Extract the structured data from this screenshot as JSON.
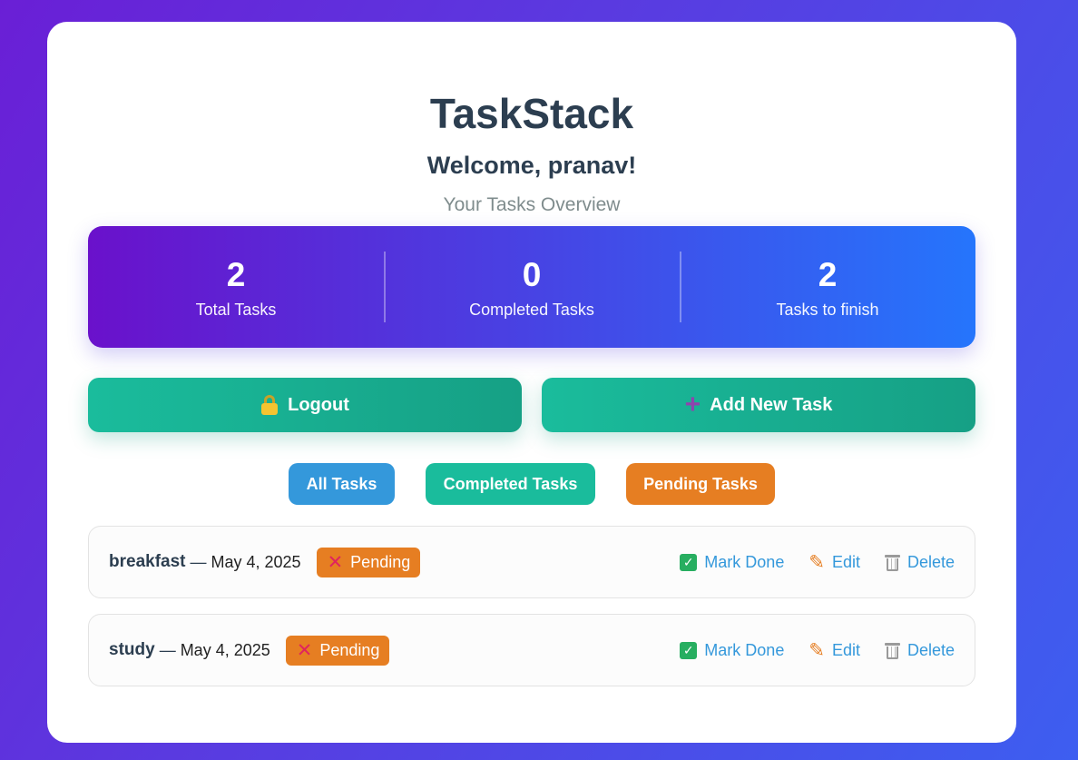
{
  "app": {
    "title": "TaskStack",
    "welcome": "Welcome, pranav!",
    "subtitle": "Your Tasks Overview"
  },
  "stats": [
    {
      "value": "2",
      "label": "Total Tasks"
    },
    {
      "value": "0",
      "label": "Completed Tasks"
    },
    {
      "value": "2",
      "label": "Tasks to finish"
    }
  ],
  "actions": {
    "logout_label": "Logout",
    "add_label": "Add New Task"
  },
  "filters": {
    "all": "All Tasks",
    "completed": "Completed Tasks",
    "pending": "Pending Tasks"
  },
  "tasks": [
    {
      "name": "breakfast",
      "separator": "—",
      "date": "May 4, 2025",
      "status": "Pending"
    },
    {
      "name": "study",
      "separator": "—",
      "date": "May 4, 2025",
      "status": "Pending"
    }
  ],
  "task_actions": {
    "mark_done": "Mark Done",
    "edit": "Edit",
    "delete": "Delete"
  },
  "icons": {
    "logout": "lock-icon",
    "add": "plus-icon",
    "status": "x-mark-icon",
    "mark_done": "check-box-icon",
    "edit": "pencil-icon",
    "delete": "trash-icon"
  },
  "colors": {
    "stats_gradient_start": "#6a11cb",
    "stats_gradient_end": "#2575fc",
    "action_button": "#1abc9c",
    "filter_all": "#3498db",
    "filter_completed": "#1abc9c",
    "filter_pending": "#e67e22",
    "pending_badge": "#e67e22",
    "action_link": "#3498db"
  }
}
